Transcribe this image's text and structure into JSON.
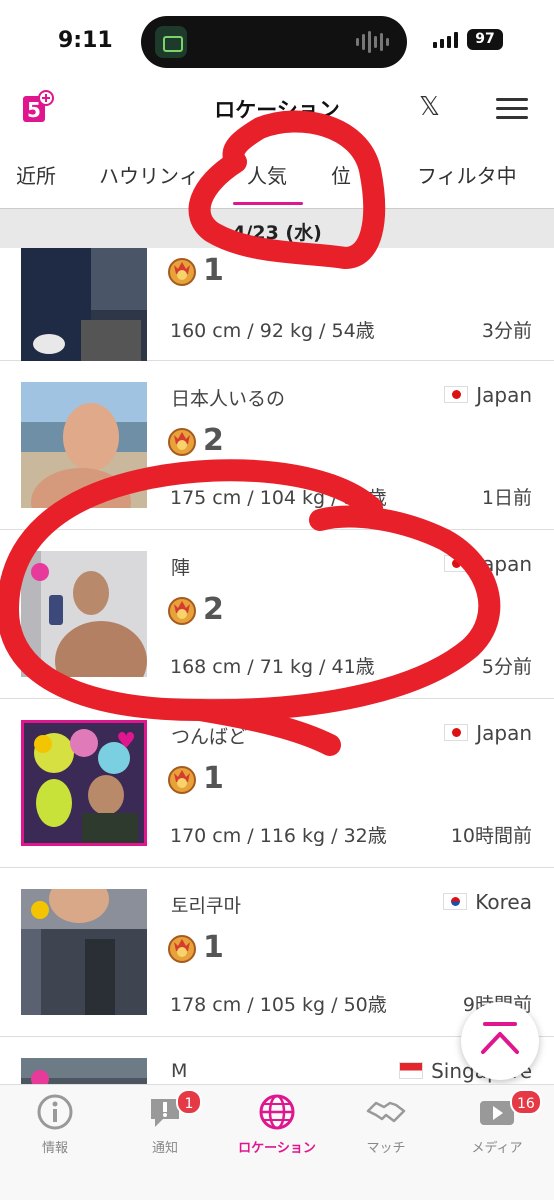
{
  "status_bar": {
    "time": "9:11",
    "battery": "97"
  },
  "header": {
    "title": "ロケーション"
  },
  "tabs": [
    {
      "label": "近所"
    },
    {
      "label": "ハウリンィ"
    },
    {
      "label": "人気"
    },
    {
      "label": "位"
    },
    {
      "label": "フィルタ中"
    }
  ],
  "active_tab": "人気",
  "date_bar": {
    "text": "4/23 (水)"
  },
  "users": [
    {
      "name": "",
      "country": "",
      "rank": "1",
      "stats": "160 cm / 92 kg / 54歳",
      "ago": "3分前",
      "dot": ""
    },
    {
      "name": "日本人いるの",
      "country": "Japan",
      "flag": "jp",
      "rank": "2",
      "stats": "175 cm / 104 kg / 53歳",
      "ago": "1日前",
      "dot": ""
    },
    {
      "name": "陣",
      "country": "Japan",
      "flag": "jp",
      "rank": "2",
      "stats": "168 cm / 71 kg / 41歳",
      "ago": "5分前",
      "dot": "#e83a9a"
    },
    {
      "name": "つんばど",
      "country": "Japan",
      "flag": "jp",
      "rank": "1",
      "stats": "170 cm / 116 kg / 32歳",
      "ago": "10時間前",
      "dot": "#f2c500",
      "favorite": true
    },
    {
      "name": "토리쿠마",
      "country": "Korea",
      "flag": "kr",
      "rank": "1",
      "stats": "178 cm / 105 kg / 50歳",
      "ago": "9時間前",
      "dot": "#f2c500"
    },
    {
      "name": "M",
      "country": "Singapore",
      "flag": "sg",
      "rank": "",
      "stats": "",
      "ago": "",
      "dot": "#e83a9a"
    }
  ],
  "bottom_nav": [
    {
      "label": "情報",
      "icon": "info-icon",
      "badge": ""
    },
    {
      "label": "通知",
      "icon": "notification-icon",
      "badge": "1"
    },
    {
      "label": "ロケーション",
      "icon": "globe-icon",
      "badge": "",
      "active": true
    },
    {
      "label": "マッチ",
      "icon": "handshake-icon",
      "badge": ""
    },
    {
      "label": "メディア",
      "icon": "media-icon",
      "badge": "16"
    }
  ],
  "colors": {
    "accent": "#e0168e",
    "marker": "#e8202a",
    "badge": "#e63946"
  }
}
